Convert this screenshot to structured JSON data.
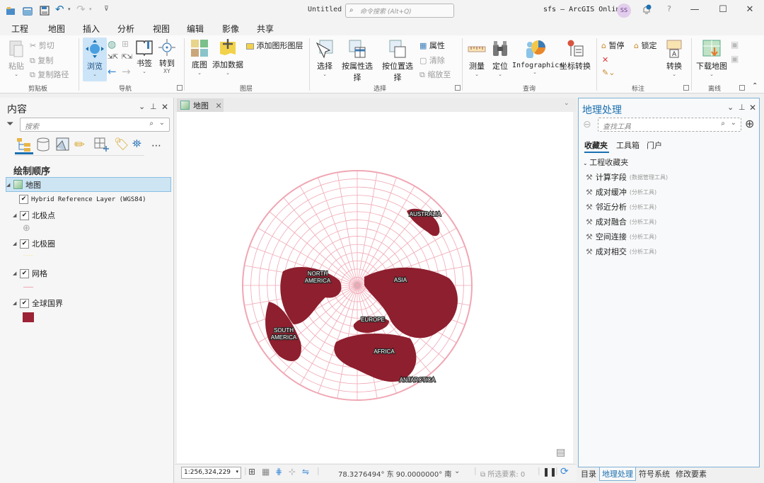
{
  "titlebar": {
    "document_title": "Untitled",
    "command_search_placeholder": "命令搜索 (Alt+Q)",
    "portal": "sfs – ArcGIS Online",
    "user_initials": "SS"
  },
  "ribbon_tabs": [
    "工程",
    "地图",
    "插入",
    "分析",
    "视图",
    "编辑",
    "影像",
    "共享"
  ],
  "active_tab": "地图",
  "ribbon": {
    "clipboard": {
      "label": "剪贴板",
      "paste": "粘贴",
      "cut": "剪切",
      "copy": "复制",
      "copy_path": "复制路径"
    },
    "navigate": {
      "label": "导航",
      "explore": "浏览",
      "bookmarks": "书签",
      "goto_xy": "转到",
      "goto_xy_sub": "XY"
    },
    "layer": {
      "label": "图层",
      "basemap": "底图",
      "add_data": "添加数据",
      "add_graphics_layer": "添加图形图层"
    },
    "selection": {
      "label": "选择",
      "select": "选择",
      "select_by_attributes": "按属性选择",
      "select_by_location": "按位置选择",
      "attributes": "属性",
      "clear": "清除",
      "zoom_to": "缩放至"
    },
    "inquiry": {
      "label": "查询",
      "measure": "测量",
      "locate": "定位",
      "infographics": "Infographics",
      "convert_coordinates": "坐标转换"
    },
    "labeling": {
      "label": "标注",
      "pause": "暂停",
      "lock": "锁定",
      "convert": "转换"
    },
    "offline": {
      "label": "离线",
      "download_map": "下载地图"
    }
  },
  "contents": {
    "title": "内容",
    "search_placeholder": "搜索",
    "section": "绘制顺序",
    "layers": [
      {
        "name": "地图",
        "type": "map",
        "selected": true
      },
      {
        "name": "Hybrid Reference Layer (WGS84)",
        "checked": true
      },
      {
        "name": "北极点",
        "checked": true,
        "expanded": true
      },
      {
        "name": "北极圈",
        "checked": true,
        "expanded": true
      },
      {
        "name": "网格",
        "checked": true,
        "expanded": true
      },
      {
        "name": "全球国界",
        "checked": true,
        "expanded": true
      }
    ],
    "fill_color": "#9b2335"
  },
  "map": {
    "tab_label": "地图",
    "labels": [
      "AUSTRALIA",
      "NORTH AMERICA",
      "ASIA",
      "EUROPE",
      "SOUTH AMERICA",
      "AFRICA",
      "ANTARCTICA"
    ],
    "land_color": "#8e1f2e",
    "grid_color": "#f0a7b4",
    "scale": "1:256,324,229",
    "coordinates": "78.3276494° 东 90.0000000° 南",
    "selected_features": "所选要素: 0"
  },
  "geoprocessing": {
    "title": "地理处理",
    "search_placeholder": "查找工具",
    "tabs": [
      "收藏夹",
      "工具箱",
      "门户"
    ],
    "active_tab": "收藏夹",
    "group": "工程收藏夹",
    "tools": [
      {
        "name": "计算字段",
        "toolbox": "(数据管理工具)"
      },
      {
        "name": "成对缓冲",
        "toolbox": "(分析工具)"
      },
      {
        "name": "邻近分析",
        "toolbox": "(分析工具)"
      },
      {
        "name": "成对融合",
        "toolbox": "(分析工具)"
      },
      {
        "name": "空间连接",
        "toolbox": "(分析工具)"
      },
      {
        "name": "成对相交",
        "toolbox": "(分析工具)"
      }
    ]
  },
  "bottom_tabs": [
    "目录",
    "地理处理",
    "符号系统",
    "修改要素"
  ],
  "bottom_active": "地理处理"
}
